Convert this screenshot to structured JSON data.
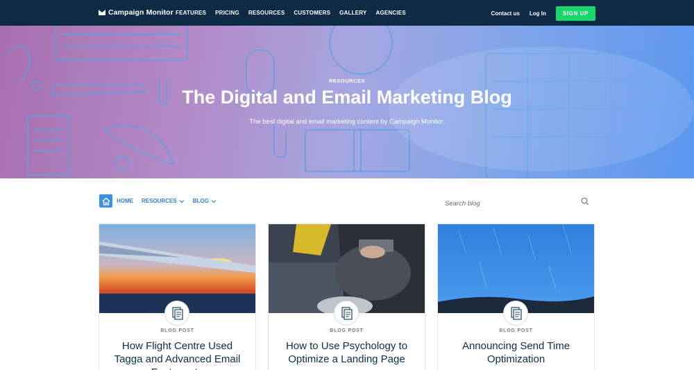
{
  "header": {
    "logo_text": "Campaign Monitor",
    "nav": [
      "FEATURES",
      "PRICING",
      "RESOURCES",
      "CUSTOMERS",
      "GALLERY",
      "AGENCIES"
    ],
    "contact_label": "Contact us",
    "login_label": "Log In",
    "signup_label": "SIGN UP"
  },
  "hero": {
    "eyebrow": "RESOURCES",
    "title": "The Digital and Email Marketing Blog",
    "subtitle": "The best digital and email marketing content by Campaign Monitor."
  },
  "subnav": {
    "home_label": "HOME",
    "resources_label": "RESOURCES",
    "blog_label": "BLOG",
    "search_placeholder": "Search blog"
  },
  "cards": [
    {
      "type": "BLOG POST",
      "title": "How Flight Centre Used Tagga and Advanced Email Features to",
      "image": "airplane-wing-sunset"
    },
    {
      "type": "BLOG POST",
      "title": "How to Use Psychology to Optimize a Landing Page",
      "image": "person-holding-tablet"
    },
    {
      "type": "BLOG POST",
      "title": "Announcing Send Time Optimization",
      "image": "blue-sky-rain-horizon"
    }
  ],
  "colors": {
    "nav_bg": "#0f2a44",
    "signup_green": "#19d56a",
    "link_blue": "#2f7fd4",
    "title_navy": "#0b2d4a"
  }
}
